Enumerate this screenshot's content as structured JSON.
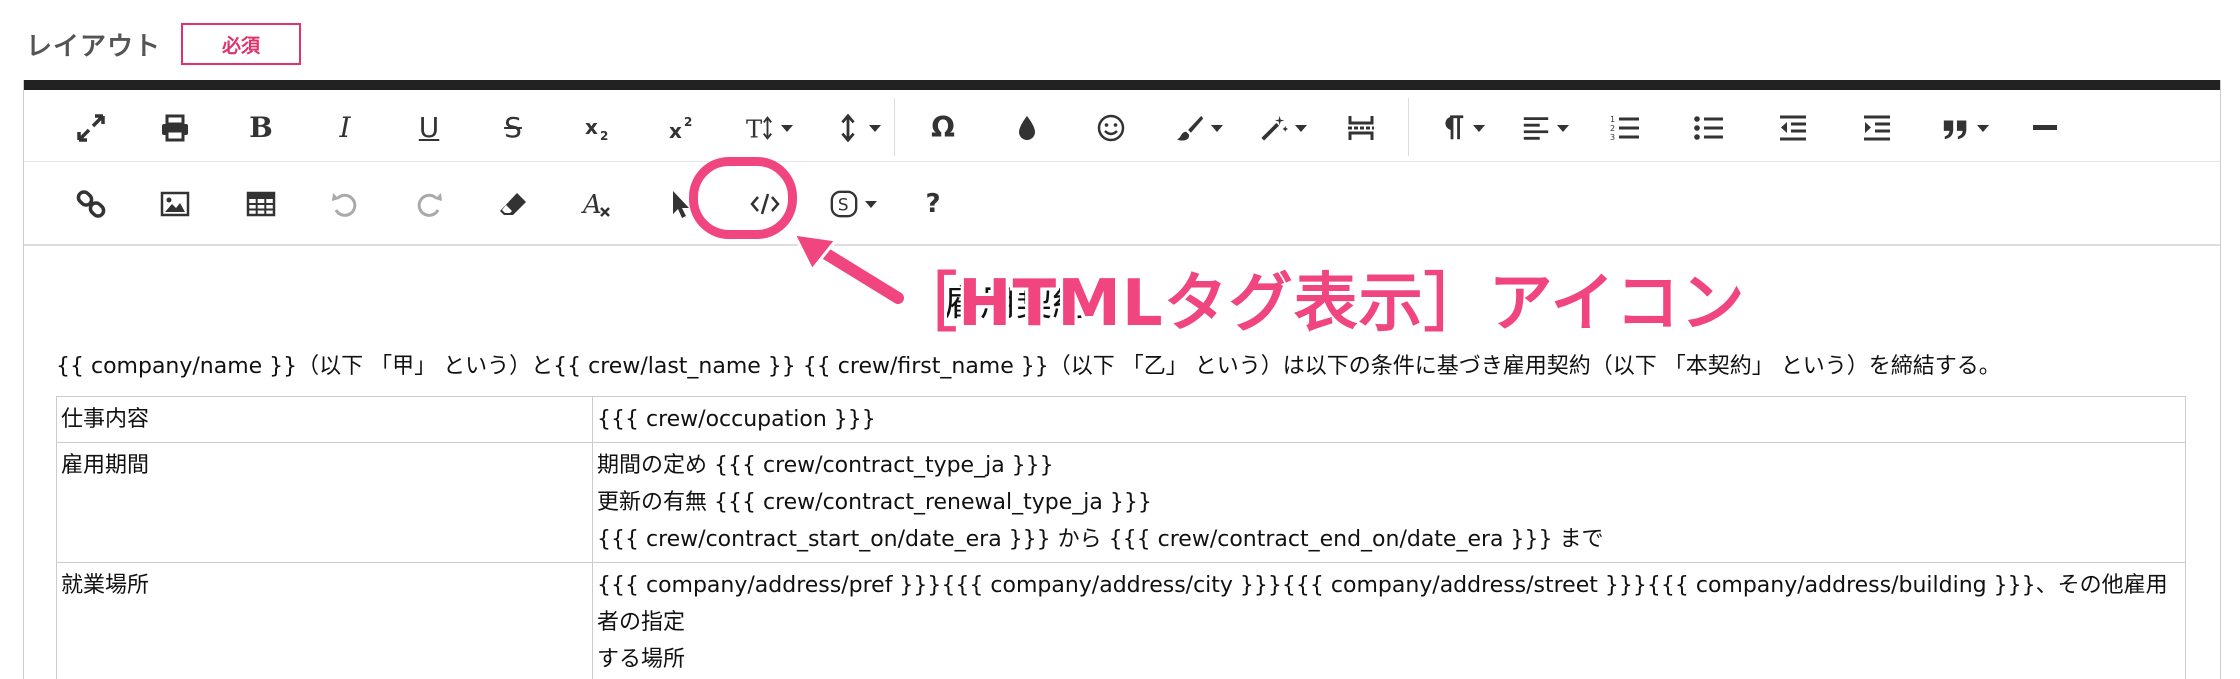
{
  "field": {
    "label": "レイアウト",
    "required_badge": "必須"
  },
  "toolbar": {
    "row1": [
      "fullscreen-icon",
      "print-icon",
      "bold-icon",
      "italic-icon",
      "underline-icon",
      "strikethrough-icon",
      "subscript-icon",
      "superscript-icon",
      "font-size-icon",
      "line-height-icon",
      "special-char-icon",
      "color-icon",
      "emoji-icon",
      "paint-format-icon",
      "magic-icon",
      "page-break-icon",
      "paragraph-icon",
      "align-icon",
      "ordered-list-icon",
      "unordered-list-icon",
      "outdent-icon",
      "indent-icon",
      "quote-icon",
      "horizontal-rule-icon"
    ],
    "row2": [
      "link-icon",
      "image-icon",
      "table-icon",
      "undo-icon",
      "redo-icon",
      "eraser-icon",
      "clear-format-icon",
      "select-icon",
      "html-code-icon",
      "variable-icon",
      "help-icon"
    ],
    "text_glyphs": {
      "bold": "B",
      "italic": "I",
      "underline": "U",
      "strike": "S",
      "omega": "Ω",
      "help": "?"
    }
  },
  "callout": {
    "text": "［HTMLタグ表示］アイコン",
    "color": "#f0457f"
  },
  "document": {
    "title": "雇用契約",
    "intro": "{{ company/name }}（以下 「甲」 という）と{{ crew/last_name }} {{ crew/first_name }}（以下 「乙」 という）は以下の条件に基づき雇用契約（以下 「本契約」 という）を締結する。",
    "rows": [
      {
        "label": "仕事内容",
        "lines": [
          "{{{ crew/occupation }}}"
        ]
      },
      {
        "label": "雇用期間",
        "lines": [
          "期間の定め {{{ crew/contract_type_ja }}}",
          "更新の有無 {{{ crew/contract_renewal_type_ja }}}",
          "{{{ crew/contract_start_on/date_era }}} から {{{ crew/contract_end_on/date_era }}} まで"
        ]
      },
      {
        "label": "就業場所",
        "lines": [
          "{{{ company/address/pref }}}{{{ company/address/city }}}{{{ company/address/street }}}{{{ company/address/building }}}、その他雇用者の指定",
          "する場所"
        ]
      }
    ]
  },
  "colors": {
    "accent": "#e0336b",
    "callout": "#f0457f",
    "toolbar_top": "#222222"
  }
}
